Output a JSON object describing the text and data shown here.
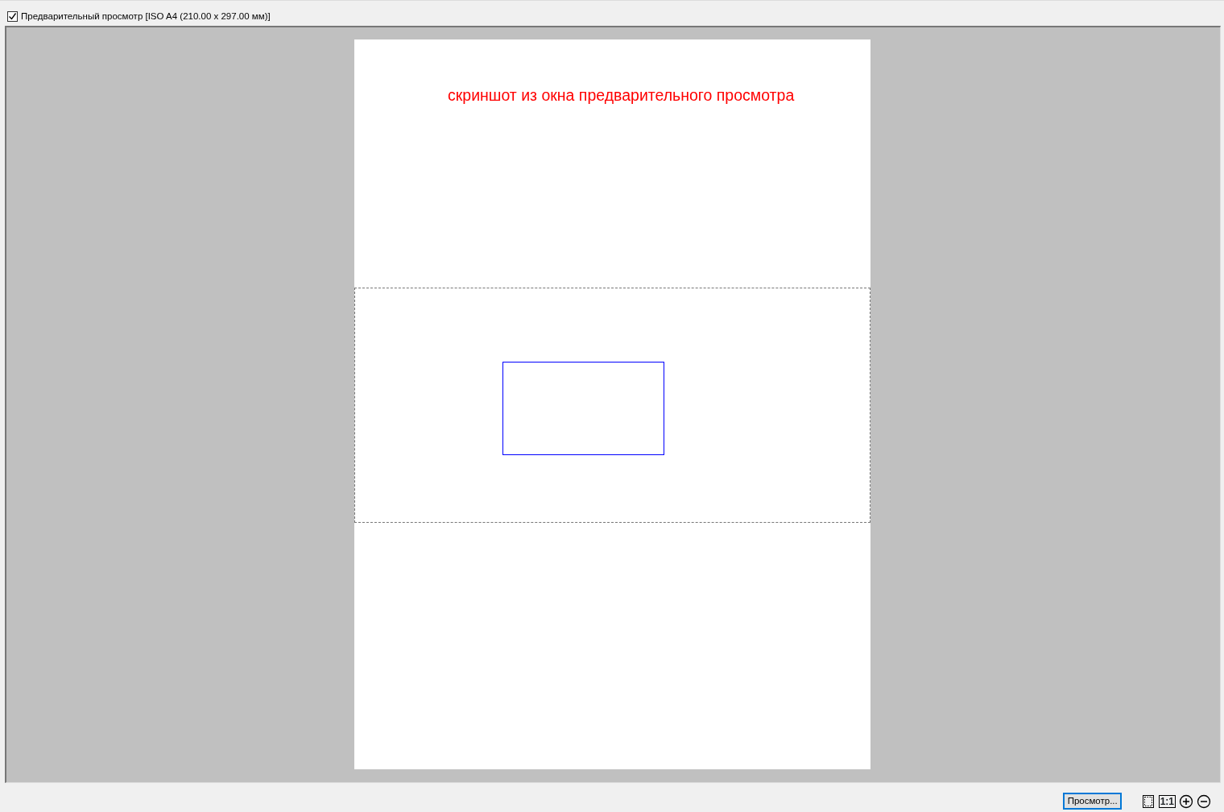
{
  "preview_toggle": {
    "label": "Предварительный просмотр [ISO A4 (210.00 x 297.00 мм)]",
    "checked": true
  },
  "page": {
    "caption": "скриншот из окна предварительного просмотра"
  },
  "footer": {
    "preview_button": "Просмотр...",
    "actual_size_label": "1:1"
  }
}
